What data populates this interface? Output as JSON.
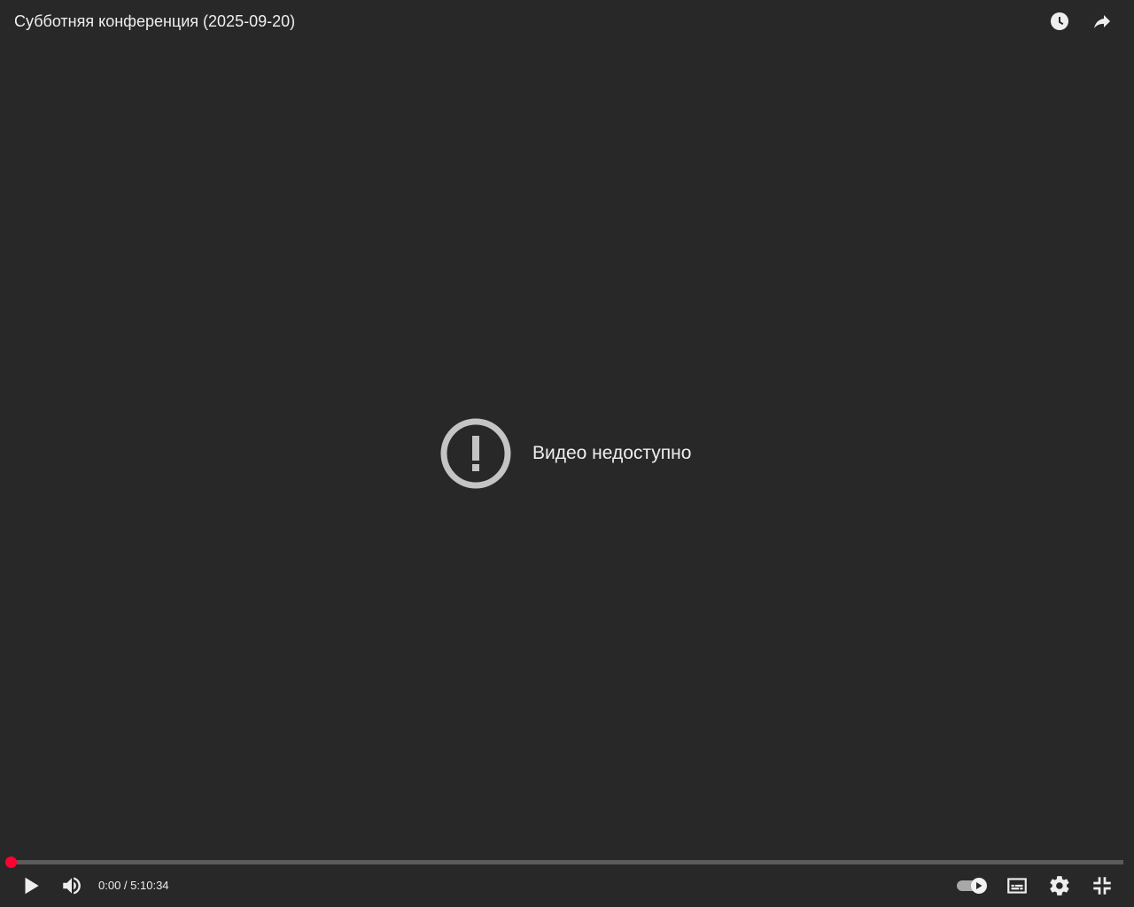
{
  "header": {
    "title": "Субботняя конференция (2025-09-20)",
    "watch_later_icon": "clock-icon",
    "share_icon": "share-arrow-icon"
  },
  "error": {
    "icon": "exclamation-circle-icon",
    "message": "Видео недоступно"
  },
  "progress": {
    "played_fraction": 0
  },
  "controls": {
    "play_icon": "play-icon",
    "volume_icon": "volume-icon",
    "current_time": "0:00",
    "separator": " / ",
    "duration": "5:10:34",
    "autoplay_enabled": true,
    "subtitles_icon": "subtitles-icon",
    "settings_icon": "gear-icon",
    "fullscreen_exit_icon": "exit-fullscreen-icon"
  },
  "colors": {
    "background": "#282828",
    "accent": "#ff0033",
    "text": "#eeeeee",
    "track": "#5b5b5b"
  }
}
